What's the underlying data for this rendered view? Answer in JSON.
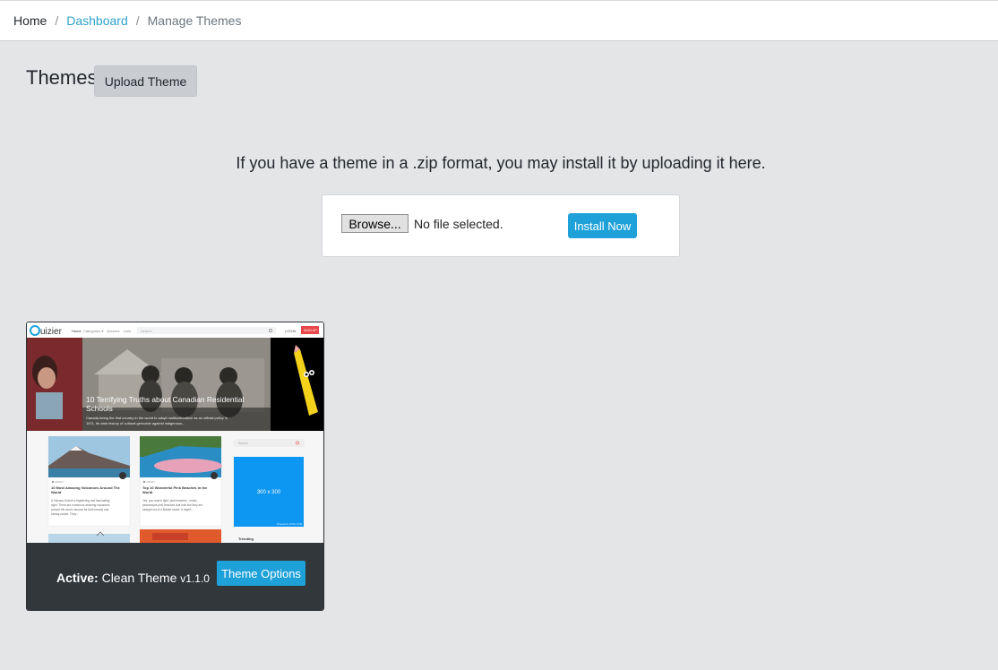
{
  "breadcrumb": {
    "home": "Home",
    "separator": "/",
    "dashboard": "Dashboard",
    "current": "Manage Themes"
  },
  "header": {
    "title": "Themes",
    "upload_button": "Upload Theme"
  },
  "upload": {
    "help_text": "If you have a theme in a .zip format, you may install it by uploading it here.",
    "browse_label": "Browse...",
    "file_status": "No file selected.",
    "install_label": "Install Now"
  },
  "theme": {
    "active_label": "Active:",
    "name": "Clean Theme",
    "version": "v1.1.0",
    "options_label": "Theme Options",
    "preview": {
      "logo": "uizier",
      "nav": [
        "Home",
        "Categories ▾",
        "Quizzes",
        "Lists"
      ],
      "search_placeholder": "Search",
      "login": "LOGIN",
      "signup": "SIGN UP",
      "hero_title": "10 Terrifying Truths about Canadian Residential Schools",
      "hero_text": "Canada being the first country in the world to adopt multiculturalism as an official policy in 1971, its dark history of cultural genocide against indigenous...",
      "card1_title": "10 Most Amazing Volcanoes Around The World",
      "card1_text": "A Volcano Eclosh a frightening and fascinating sight. There are numerous amazing volcanoes around the world, famous for their beauty and steady nature. They...",
      "card2_title": "Top 10 Wonderful Pink Beaches in the World",
      "card2_text": "Yes, you read it right: pink beaches - exotic, picturesque pink beaches that look like they are straight out of a Barbie movie. It might...",
      "card_author": "ADMIN",
      "sidebar_search": "Search",
      "ad_label": "300 x 300",
      "ad_credit": "Powered by HTML.COM",
      "trending": "Trending"
    }
  },
  "colors": {
    "accent": "#1ea1d9",
    "link": "#2ea2cc",
    "background": "#e4e5e7",
    "footer": "#32373c"
  }
}
